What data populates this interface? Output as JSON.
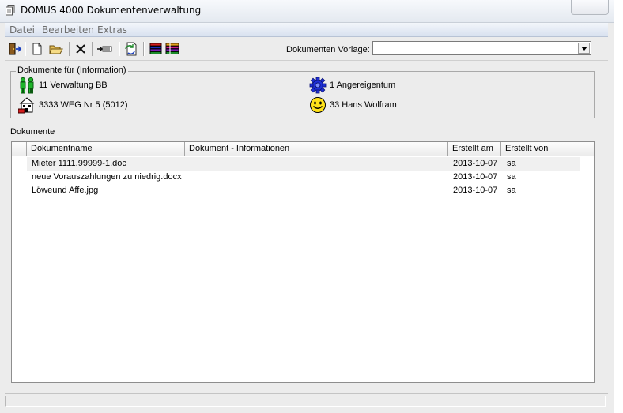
{
  "window": {
    "title": "DOMUS 4000 Dokumentenverwaltung",
    "title_icon": "document-stack-icon"
  },
  "menu": {
    "items": [
      {
        "label": "Datei"
      },
      {
        "label": "Bearbeiten"
      },
      {
        "label": "Extras"
      }
    ]
  },
  "toolbar": {
    "buttons": [
      {
        "icon": "exit-door-icon"
      },
      {
        "icon": "new-document-icon"
      },
      {
        "icon": "open-folder-icon"
      },
      {
        "icon": "delete-x-icon"
      },
      {
        "icon": "import-arrow-icon"
      },
      {
        "icon": "refresh-document-icon"
      },
      {
        "icon": "colored-list-icon"
      },
      {
        "icon": "colored-list-alt-icon"
      }
    ],
    "vorlage_label": "Dokumenten Vorlage:",
    "vorlage_value": ""
  },
  "info": {
    "legend": "Dokumente für (Information)",
    "entries": [
      {
        "icon": "persons-icon",
        "text": "11 Verwaltung BB"
      },
      {
        "icon": "gear-icon",
        "text": "1 Angereigentum"
      },
      {
        "icon": "building-icon",
        "text": "3333 WEG Nr 5 (5012)"
      },
      {
        "icon": "smiley-icon",
        "text": "33 Hans Wolfram"
      }
    ]
  },
  "documents": {
    "label": "Dokumente",
    "columns": [
      {
        "label": ""
      },
      {
        "label": "Dokumentname"
      },
      {
        "label": "Dokument - Informationen"
      },
      {
        "label": "Erstellt am"
      },
      {
        "label": "Erstellt von"
      }
    ],
    "rows": [
      {
        "name": "Mieter 1111.99999-1.doc",
        "info": "",
        "date": "2013-10-07",
        "by": "sa"
      },
      {
        "name": "neue Vorauszahlungen zu niedrig.docx",
        "info": "",
        "date": "2013-10-07",
        "by": "sa"
      },
      {
        "name": "Löweund Affe.jpg",
        "info": "",
        "date": "2013-10-07",
        "by": "sa"
      }
    ]
  },
  "colors": {
    "menubar": "#d8e1ef",
    "window_bg": "#ececec",
    "list_bg": "#ffffff"
  }
}
